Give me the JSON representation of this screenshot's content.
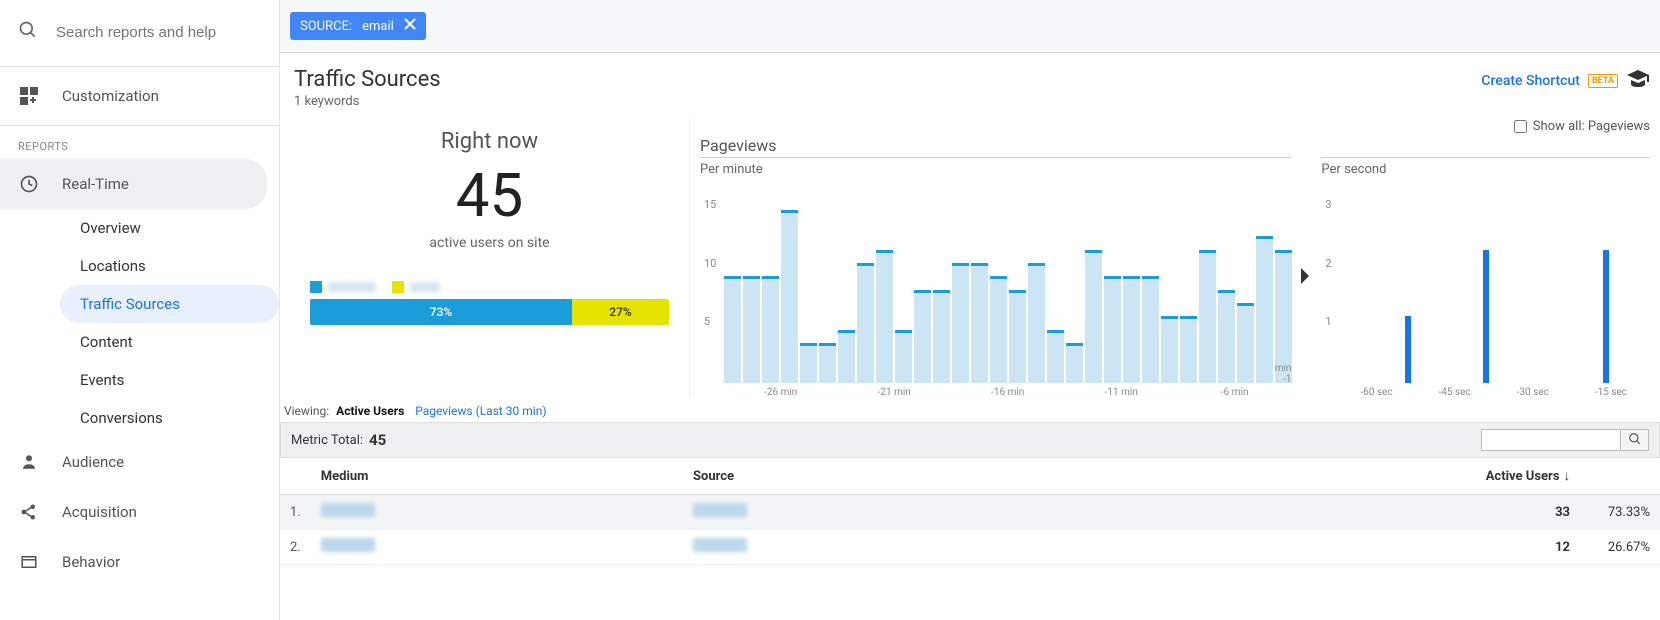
{
  "search": {
    "placeholder": "Search reports and help"
  },
  "sidebar": {
    "custom": "Customization",
    "reports_label": "REPORTS",
    "realtime": "Real-Time",
    "sub": {
      "overview": "Overview",
      "locations": "Locations",
      "traffic": "Traffic Sources",
      "content": "Content",
      "events": "Events",
      "conversions": "Conversions"
    },
    "audience": "Audience",
    "acquisition": "Acquisition",
    "behavior": "Behavior"
  },
  "filter": {
    "chip_label": "SOURCE:",
    "chip_value": "email"
  },
  "header": {
    "title": "Traffic Sources",
    "subtitle": "1 keywords",
    "shortcut": "Create Shortcut",
    "beta": "BETA"
  },
  "rightnow": {
    "label": "Right now",
    "value": "45",
    "sub": "active users on site"
  },
  "split": {
    "a_color": "#1a9dd9",
    "a_pct": "73%",
    "b_color": "#e4e400",
    "b_pct": "27%"
  },
  "charts": {
    "title": "Pageviews",
    "showall": "Show all: Pageviews",
    "per_minute": "Per minute",
    "per_second": "Per second",
    "x_min_labels": [
      "-26 min",
      "-21 min",
      "-16 min",
      "-11 min",
      "-6 min"
    ],
    "x_min_end": "min\n-1",
    "x_sec_labels": [
      "-60 sec",
      "-45 sec",
      "-30 sec",
      "-15 sec"
    ],
    "y_min": [
      "15",
      "10",
      "5"
    ],
    "y_sec": [
      "3",
      "2",
      "1"
    ]
  },
  "viewing": {
    "label": "Viewing:",
    "opt1": "Active Users",
    "opt2": "Pageviews (Last 30 min)"
  },
  "metric": {
    "label": "Metric Total:",
    "value": "45"
  },
  "table": {
    "cols": {
      "medium": "Medium",
      "source": "Source",
      "active": "Active Users"
    },
    "rows": [
      {
        "idx": "1.",
        "count": "33",
        "pct": "73.33%"
      },
      {
        "idx": "2.",
        "count": "12",
        "pct": "26.67%"
      }
    ]
  },
  "chart_data": {
    "per_minute": {
      "type": "bar",
      "title": "Pageviews — Per minute",
      "xlabel": "min",
      "ylabel": "Pageviews",
      "ylim": [
        0,
        15
      ],
      "x": [
        -30,
        -29,
        -28,
        -27,
        -26,
        -25,
        -24,
        -23,
        -22,
        -21,
        -20,
        -19,
        -18,
        -17,
        -16,
        -15,
        -14,
        -13,
        -12,
        -11,
        -10,
        -9,
        -8,
        -7,
        -6,
        -5,
        -4,
        -3,
        -2,
        -1
      ],
      "values": [
        8,
        8,
        8,
        13,
        3,
        3,
        4,
        9,
        10,
        4,
        7,
        7,
        9,
        9,
        8,
        7,
        9,
        4,
        3,
        10,
        8,
        8,
        8,
        5,
        5,
        10,
        7,
        6,
        11,
        10
      ]
    },
    "per_second": {
      "type": "bar",
      "title": "Pageviews — Per second",
      "xlabel": "sec",
      "ylabel": "Pageviews",
      "ylim": [
        0,
        3
      ],
      "x": [
        -60,
        -59,
        -58,
        -57,
        -56,
        -55,
        -54,
        -53,
        -52,
        -51,
        -50,
        -49,
        -48,
        -47,
        -46,
        -45,
        -44,
        -43,
        -42,
        -41,
        -40,
        -39,
        -38,
        -37,
        -36,
        -35,
        -34,
        -33,
        -32,
        -31,
        -30,
        -29,
        -28,
        -27,
        -26,
        -25,
        -24,
        -23,
        -22,
        -21,
        -20,
        -19,
        -18,
        -17,
        -16,
        -15,
        -14,
        -13,
        -12,
        -11,
        -10,
        -9,
        -8,
        -7,
        -6,
        -5,
        -4,
        -3,
        -2,
        -1
      ],
      "values": [
        0,
        0,
        0,
        0,
        0,
        0,
        0,
        0,
        0,
        0,
        0,
        0,
        0,
        1,
        0,
        0,
        0,
        0,
        0,
        0,
        0,
        0,
        0,
        0,
        0,
        0,
        0,
        0,
        2,
        0,
        0,
        0,
        0,
        0,
        0,
        0,
        0,
        0,
        0,
        0,
        0,
        0,
        0,
        0,
        0,
        0,
        0,
        0,
        0,
        0,
        0,
        2,
        0,
        0,
        0,
        0,
        0,
        0,
        0,
        0
      ]
    }
  }
}
